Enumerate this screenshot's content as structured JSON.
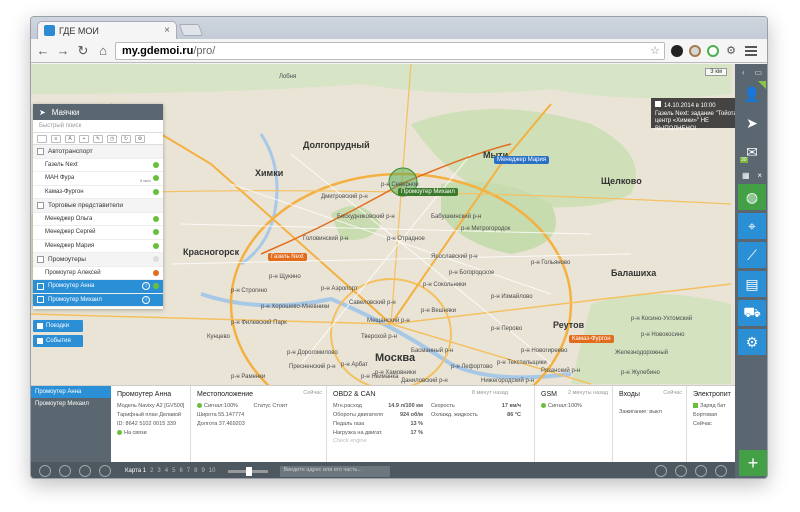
{
  "browser": {
    "tab_title": "ГДЕ МОИ",
    "url_host": "my.gdemoi.ru",
    "url_path": "/pro/"
  },
  "map": {
    "scale": "3 км",
    "labels": {
      "moscow": "Москва",
      "khimki": "Химки",
      "krasnogorsk": "Красногорск",
      "dolgoprudny": "Долгопрудный",
      "mytishchi": "Мыти",
      "balashikha": "Балашиха",
      "schelkovo": "Щелково",
      "reutov": "Реутов",
      "zheleznodorozhny": "Железнодорожный",
      "kuntsevo": "Кунцево",
      "lobnya": "Лобня",
      "severnoe": "р-н Северное",
      "khamovniki": "р-н Хамовники",
      "presnensky": "Пресненский р-н",
      "meshchansky": "Мещанский р-н",
      "tverskoy": "Тверской р-н",
      "basmanny": "Басманный р-н",
      "sokolniki": "р-н Сокольники",
      "metrogorodok": "р-н Метрогородок",
      "izmaylovo": "р-н Измайлово",
      "perovo": "р-н Перово",
      "veshnyaki": "р-н Вешняки",
      "novogireevo": "р-н Новогиреево",
      "lefortovo": "р-н Лефортово",
      "dmitrovsky": "Дмитровский р-н",
      "beskudnikovsky": "Бескудниковский р-н",
      "golovinsky": "Головинский р-н",
      "khoroshevo": "р-н Хорошево-Мневники",
      "shchukino": "р-н Щукино",
      "strogino": "р-н Строгино",
      "aeroport": "р-н Аэропорт",
      "savelovsky": "Савеловский р-н",
      "otradnoe": "р-н Отрадное",
      "babushkinsky": "Бабушкинский р-н",
      "yaroslavsky": "Ярославский р-н",
      "bogorodskoe": "р-н Богородское",
      "golyanovo": "р-н Гольяново",
      "kosino": "р-н Косино-Ухтомский",
      "novokosino": "р-н Новокосино",
      "zhulebino": "р-н Жулебино",
      "filevsky": "р-н Филевский Парк",
      "ramenki": "р-н Раменки",
      "dorogomilovo": "р-н Дорогомилово",
      "arbat": "р-н Арбат",
      "yakimanka": "р-н Якиманка",
      "danilovsky": "Даниловский р-н",
      "nizhegorodsky": "Нижегородский р-н",
      "ryazansky": "Рязанский р-н",
      "tekstilshchiki": "р-н Текстильщики"
    },
    "tags": {
      "promoter_mikhail": "Промоутер Михаил",
      "manager_maria": "Менеджер Мария",
      "gazel_next": "Газель Next",
      "kamaz_furgon": "Камаз-Фургон"
    }
  },
  "notification": {
    "time": "14.10.2014 в 10:00",
    "text": "Газель Next: задание \"Тойота-центр «Химки»\" НЕ ВЫПОЛНЕНО!"
  },
  "panel": {
    "title": "Маячки",
    "search_placeholder": "Быстрый поиск",
    "groups": [
      {
        "label": "Автотранспорт"
      },
      {
        "label": "Торговые представители"
      },
      {
        "label": "Промоутеры"
      }
    ],
    "items": {
      "gazel": "Газель Next",
      "man": "МАН Фура",
      "kamaz": "Камаз-Фургон",
      "olga": "Менеджер Ольга",
      "sergey": "Менеджер Сергей",
      "maria": "Менеджер Мария",
      "alexey": "Промоутер Алексей",
      "anna": "Промоутер Анна",
      "mikhail": "Промоутер Михаил"
    },
    "speed": "5 км/ч",
    "trips_button": "Поездки",
    "events_button": "События"
  },
  "details": {
    "list": [
      "Промоутер Анна",
      "Промоутер Михаил"
    ],
    "device": {
      "title": "Промоутер Анна",
      "model": "Модель Navixy A2 [GV500]",
      "tariff": "Тарифный план Делавой",
      "id": "ID: 8642 5102 0015 339",
      "link": "На связи"
    },
    "location": {
      "title": "Местоположение",
      "time": "Сейчас",
      "signal": "Сигнал:100%",
      "status": "Статус Стоит",
      "lat": "Широта 55.147774",
      "lon": "Долгота 37.469203"
    },
    "obd": {
      "title": "OBD2 & CAN",
      "time": "8 минут назад",
      "fuel": "Мгн.расход",
      "fuel_v": "14.9 л/100 км",
      "rpm": "Обороты двигателя",
      "rpm_v": "924 об/м",
      "pedal": "Педаль газа",
      "pedal_v": "13 %",
      "load": "Нагрузка на двигат.",
      "load_v": "17 %",
      "check": "Check engine",
      "speed": "Скорость",
      "speed_v": "17 км/ч",
      "coolant": "Охлажд. жидкость",
      "coolant_v": "86 °C"
    },
    "gsm": {
      "title": "GSM",
      "time": "2 минуты назад",
      "signal": "Сигнал:100%"
    },
    "inputs": {
      "title": "Входы",
      "time": "Сейчас",
      "ignition": "Зажигание: выкл"
    },
    "power": {
      "title": "Электропит",
      "charge": "Заряд бат",
      "board": "Бортовая",
      "time": "Сейчас"
    }
  },
  "bottombar": {
    "cards_label": "Карта 1",
    "cards": [
      "2",
      "3",
      "4",
      "5",
      "6",
      "7",
      "8",
      "9",
      "10"
    ],
    "address_placeholder": "Введите адрес или его часть..."
  }
}
